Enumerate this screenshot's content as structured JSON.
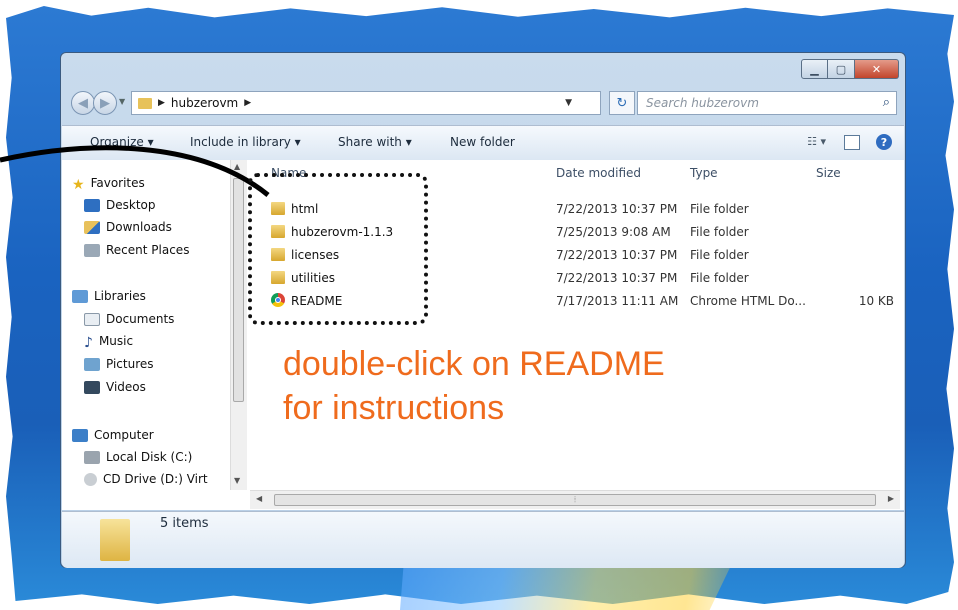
{
  "address": {
    "folder": "hubzerovm"
  },
  "search": {
    "placeholder": "Search hubzerovm"
  },
  "toolbar": {
    "organize": "Organize ▾",
    "include": "Include in library ▾",
    "share": "Share with ▾",
    "new_folder": "New folder"
  },
  "nav": {
    "favorites": "Favorites",
    "desktop": "Desktop",
    "downloads": "Downloads",
    "recent": "Recent Places",
    "libraries": "Libraries",
    "documents": "Documents",
    "music": "Music",
    "pictures": "Pictures",
    "videos": "Videos",
    "computer": "Computer",
    "local_disk": "Local Disk (C:)",
    "cd_drive": "CD Drive (D:) Virt"
  },
  "columns": {
    "name": "Name",
    "date": "Date modified",
    "type": "Type",
    "size": "Size"
  },
  "files": [
    {
      "name": "html",
      "date": "7/22/2013 10:37 PM",
      "type": "File folder",
      "size": "",
      "icon": "folder-icon"
    },
    {
      "name": "hubzerovm-1.1.3",
      "date": "7/25/2013 9:08 AM",
      "type": "File folder",
      "size": "",
      "icon": "folder-icon"
    },
    {
      "name": "licenses",
      "date": "7/22/2013 10:37 PM",
      "type": "File folder",
      "size": "",
      "icon": "folder-icon"
    },
    {
      "name": "utilities",
      "date": "7/22/2013 10:37 PM",
      "type": "File folder",
      "size": "",
      "icon": "folder-icon"
    },
    {
      "name": "README",
      "date": "7/17/2013 11:11 AM",
      "type": "Chrome HTML Do...",
      "size": "10 KB",
      "icon": "chrome-icon"
    }
  ],
  "status": {
    "count": "5 items"
  },
  "annotation": {
    "line1": "double-click on README",
    "line2": "for instructions"
  },
  "colors": {
    "annotation": "#ef6b1d",
    "desktop": "#1a63c0"
  }
}
